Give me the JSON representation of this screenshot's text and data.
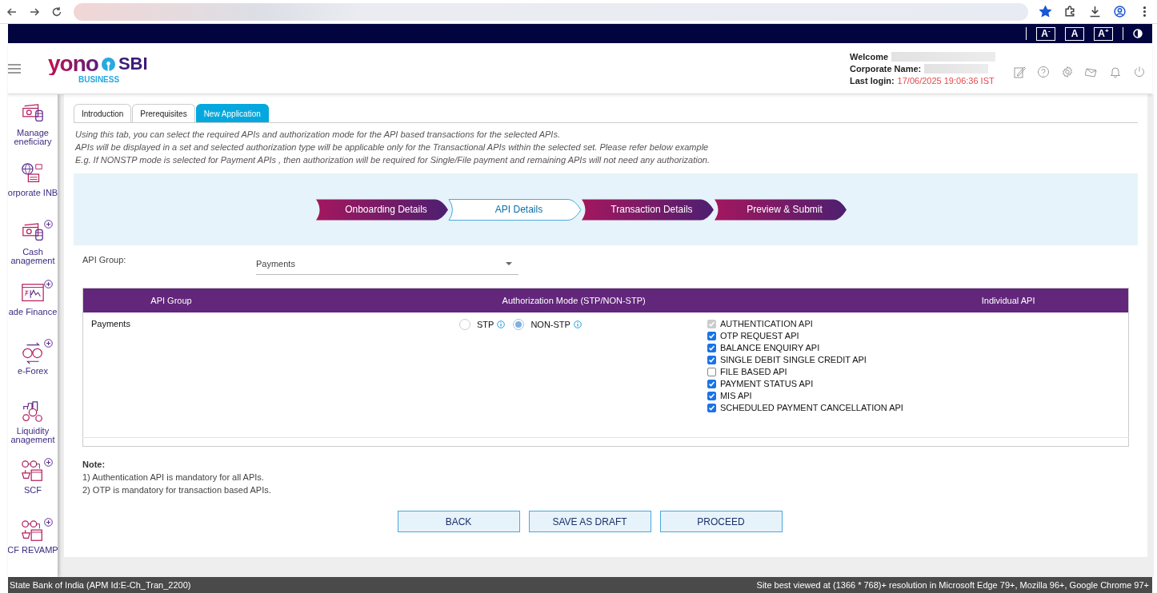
{
  "font_controls": [
    {
      "label": "A$^{-}$"
    },
    {
      "label": "A"
    },
    {
      "label": "A$^{+}$"
    }
  ],
  "header": {
    "logo": {
      "wordmark": "yono",
      "brand": "SBI",
      "sub": "BUSINESS"
    },
    "welcome_label": "Welcome",
    "corporate_label": "Corporate Name:",
    "last_login_label": "Last login:",
    "last_login_value": "17/06/2025 19:06:36 IST"
  },
  "sidebar": {
    "items": [
      {
        "lines": [
          "Manage",
          "eneficiary"
        ],
        "has_plus": false
      },
      {
        "lines": [
          "orporate INB"
        ],
        "has_plus": false
      },
      {
        "lines": [
          "Cash",
          "anagement"
        ],
        "has_plus": true
      },
      {
        "lines": [
          "ade Finance"
        ],
        "has_plus": true
      },
      {
        "lines": [
          "e-Forex"
        ],
        "has_plus": true
      },
      {
        "lines": [
          "Liquidity",
          "anagement"
        ],
        "has_plus": false
      },
      {
        "lines": [
          "SCF"
        ],
        "has_plus": true
      },
      {
        "lines": [
          "CF REVAMP"
        ],
        "has_plus": true
      }
    ]
  },
  "tabs": [
    {
      "label": "Introduction",
      "selected": false
    },
    {
      "label": "Prerequisites",
      "selected": false
    },
    {
      "label": "New Application",
      "selected": true
    }
  ],
  "intro_lines": [
    "Using this tab, you can select the required APIs and authorization mode for the API based transactions for the selected APIs.",
    "APIs will be displayed in a set and selected authorization type will be applicable only for the Transactional APIs within the selected set. Please refer below example",
    "E.g. If NONSTP mode is selected for Payment APIs , then authorization will be required for Single/File payment and remaining APIs will not need any authorization."
  ],
  "steps": [
    {
      "label": "Onboarding Details",
      "selected": false
    },
    {
      "label": "API Details",
      "selected": true
    },
    {
      "label": "Transaction Details",
      "selected": false
    },
    {
      "label": "Preview & Submit",
      "selected": false
    }
  ],
  "api_group_field": {
    "label": "API Group:",
    "value": "Payments"
  },
  "table": {
    "columns": [
      "API Group",
      "Authorization Mode (STP/NON-STP)",
      "Individual API"
    ],
    "rows": [
      {
        "group": "Payments",
        "modes": [
          {
            "label": "STP",
            "selected": false
          },
          {
            "label": "NON-STP",
            "selected": true
          }
        ],
        "apis": [
          {
            "label": "AUTHENTICATION API",
            "checked": true,
            "disabled": true
          },
          {
            "label": "OTP REQUEST API",
            "checked": true,
            "disabled": false
          },
          {
            "label": "BALANCE ENQUIRY API",
            "checked": true,
            "disabled": false
          },
          {
            "label": "SINGLE DEBIT SINGLE CREDIT API",
            "checked": true,
            "disabled": false
          },
          {
            "label": "FILE BASED API",
            "checked": false,
            "disabled": false
          },
          {
            "label": "PAYMENT STATUS API",
            "checked": true,
            "disabled": false
          },
          {
            "label": "MIS API",
            "checked": true,
            "disabled": false
          },
          {
            "label": "SCHEDULED PAYMENT CANCELLATION API",
            "checked": true,
            "disabled": false
          }
        ]
      }
    ]
  },
  "note": {
    "title": "Note:",
    "lines": [
      "1) Authentication API is mandatory for all APIs.",
      "2) OTP is mandatory for transaction based APIs."
    ]
  },
  "buttons": [
    "BACK",
    "SAVE AS DRAFT",
    "PROCEED"
  ],
  "footer": {
    "left": "State Bank of India (APM Id:E-Ch_Tran_2200)",
    "right": "Site best viewed at (1366 * 768)+ resolution in Microsoft Edge 79+, Mozilla 96+, Google Chrome 97+"
  }
}
